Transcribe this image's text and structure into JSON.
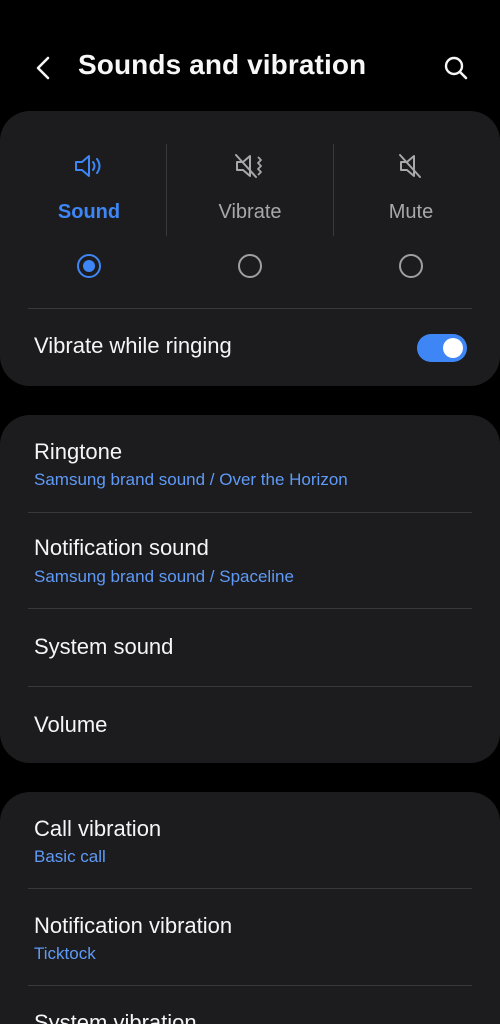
{
  "header": {
    "title": "Sounds and vibration"
  },
  "sound_mode": {
    "options": [
      {
        "label": "Sound",
        "icon": "speaker-icon",
        "selected": true
      },
      {
        "label": "Vibrate",
        "icon": "vibrate-icon",
        "selected": false
      },
      {
        "label": "Mute",
        "icon": "mute-icon",
        "selected": false
      }
    ],
    "vibrate_while_ringing": {
      "label": "Vibrate while ringing",
      "enabled": true
    }
  },
  "sounds": {
    "items": [
      {
        "title": "Ringtone",
        "subtitle": "Samsung brand sound / Over the Horizon"
      },
      {
        "title": "Notification sound",
        "subtitle": "Samsung brand sound / Spaceline"
      },
      {
        "title": "System sound"
      },
      {
        "title": "Volume"
      }
    ]
  },
  "vibration": {
    "items": [
      {
        "title": "Call vibration",
        "subtitle": "Basic call"
      },
      {
        "title": "Notification vibration",
        "subtitle": "Ticktock"
      },
      {
        "title": "System vibration"
      }
    ]
  },
  "colors": {
    "background": "#000000",
    "card": "#1c1c1e",
    "accent": "#3e86f5",
    "subtitle": "#5f9af7"
  }
}
